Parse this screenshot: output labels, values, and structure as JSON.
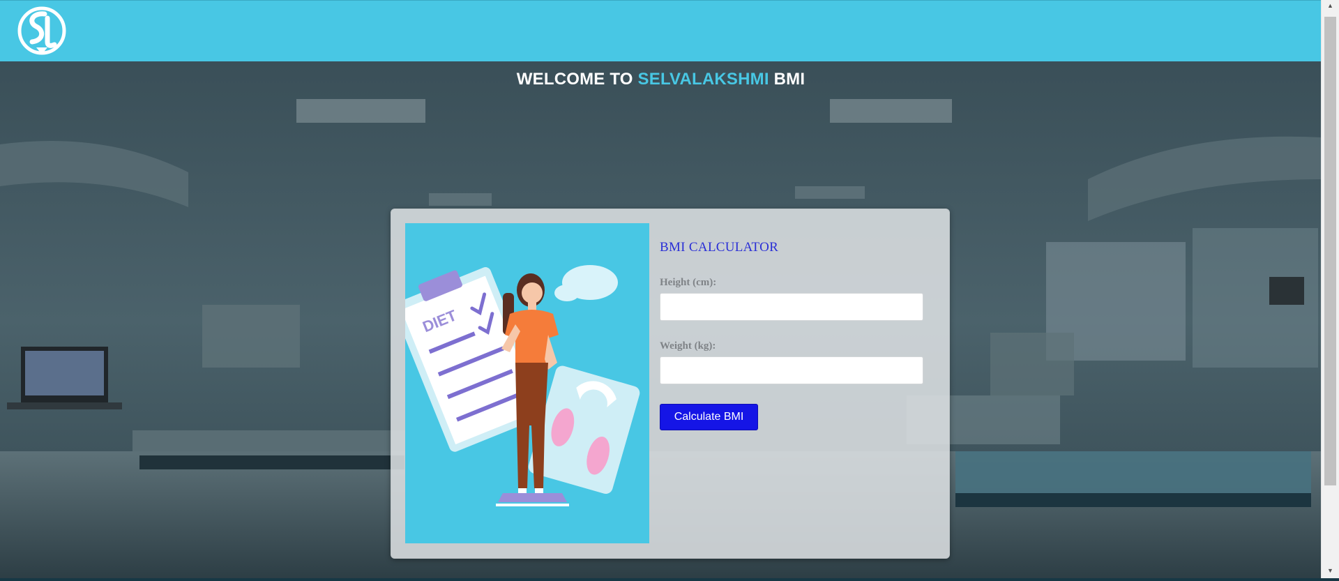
{
  "header": {
    "logo_alt": "SL",
    "color": "#48c7e4"
  },
  "welcome": {
    "prefix": "WELCOME TO ",
    "brand": "SELVALAKSHMI",
    "suffix": " BMI"
  },
  "illustration": {
    "clipboard_text": "DIET"
  },
  "form": {
    "title": "BMI CALCULATOR",
    "height_label": "Height (cm):",
    "height_value": "",
    "weight_label": "Weight (kg):",
    "weight_value": "",
    "button_label": "Calculate BMI"
  },
  "colors": {
    "brand_cyan": "#48c7e4",
    "button_blue": "#1515e6",
    "title_blue": "#2a2fd6"
  },
  "icons": {
    "scroll_up": "▲",
    "scroll_down": "▼"
  }
}
